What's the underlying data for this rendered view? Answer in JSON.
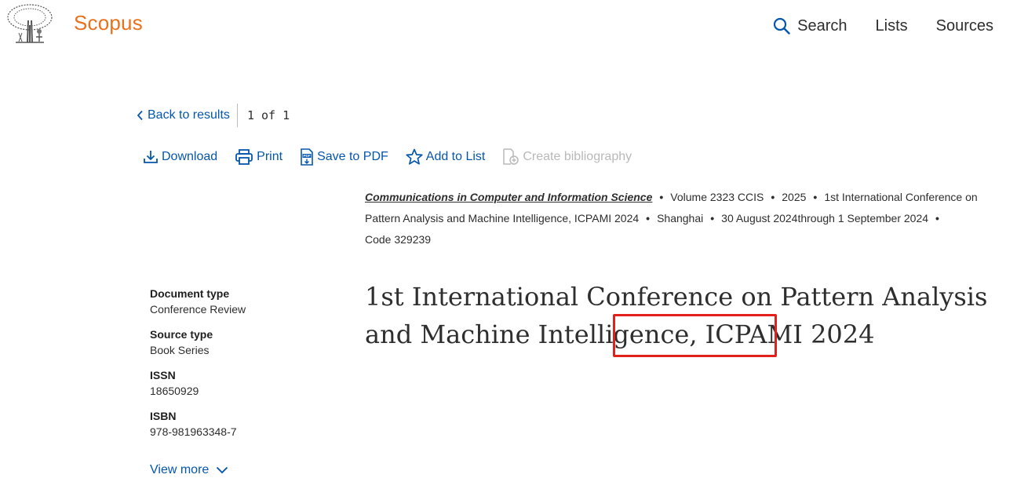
{
  "header": {
    "brand": "Scopus",
    "nav": {
      "search": "Search",
      "lists": "Lists",
      "sources": "Sources"
    }
  },
  "back_row": {
    "back": "Back to results",
    "pager": "1 of 1"
  },
  "toolbar": {
    "download": "Download",
    "print": "Print",
    "save_pdf": "Save to PDF",
    "add_list": "Add to List",
    "bibliography": "Create bibliography"
  },
  "source": {
    "journal": "Communications in Computer and Information Science",
    "volume": "Volume 2323 CCIS",
    "year": "2025",
    "conference": "1st International Conference on Pattern Analysis and Machine Intelligence, ICPAMI 2024",
    "location": "Shanghai",
    "dates": "30 August 2024through 1 September 2024",
    "code": "Code 329239"
  },
  "meta": {
    "doc_type_label": "Document type",
    "doc_type": "Conference Review",
    "source_type_label": "Source type",
    "source_type": "Book Series",
    "issn_label": "ISSN",
    "issn": "18650929",
    "isbn_label": "ISBN",
    "isbn": "978-981963348-7",
    "view_more": "View more"
  },
  "title": {
    "main": "1st International Conference on Pattern Analysis and Machine Intelligence,",
    "highlighted": "ICPAMI 2024"
  },
  "colors": {
    "brand": "#e9711c",
    "link": "#0656ad",
    "highlight": "#e3201b"
  }
}
